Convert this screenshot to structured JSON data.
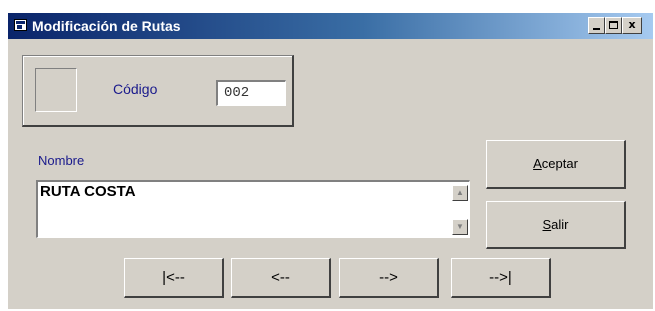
{
  "window": {
    "title": "Modificación de Rutas",
    "controls": {
      "minimize": "_",
      "maximize": "□",
      "close": "x"
    }
  },
  "icons": {
    "window_icon": "app-window-icon",
    "scroll_up": "scroll-up-arrow-icon",
    "scroll_down": "scroll-down-arrow-icon"
  },
  "form": {
    "codigo_label": "Código",
    "codigo_value": "002",
    "nombre_label": "Nombre",
    "nombre_value": "RUTA COSTA"
  },
  "buttons": {
    "aceptar": {
      "accel": "A",
      "rest": "ceptar"
    },
    "salir": {
      "accel": "S",
      "rest": "alir"
    }
  },
  "navigation": {
    "first": "|<--",
    "prev": "<--",
    "next": "-->",
    "last": "-->|"
  },
  "colors": {
    "titlebar_start": "#0a246a",
    "titlebar_end": "#a6caf0",
    "window_face": "#d4d0c8",
    "label_text": "#1a1a8c"
  }
}
